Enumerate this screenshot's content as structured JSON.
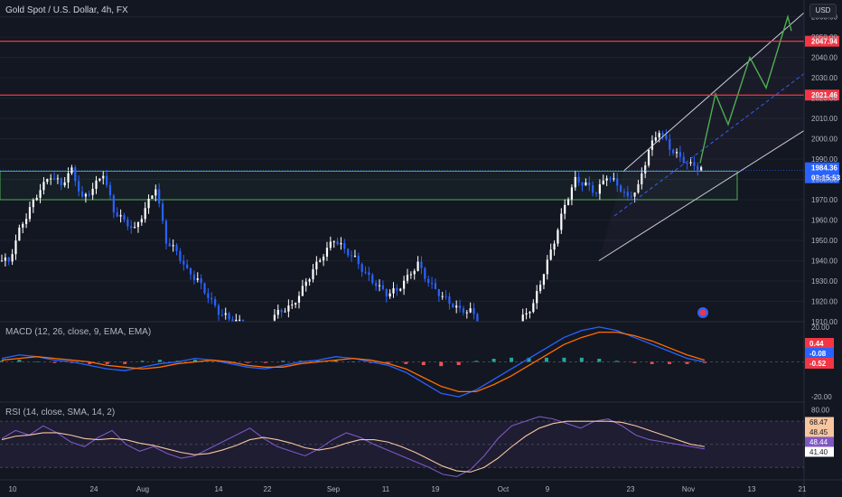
{
  "chart_title": "Gold Spot / U.S. Dollar, 4h, FX",
  "currency_button": "USD",
  "macd_label": "MACD (12, 26, close, 9, EMA, EMA)",
  "rsi_label": "RSI (14, close, SMA, 14, 2)",
  "colors": {
    "background": "#131722",
    "candle_up": "#ffffff",
    "candle_down": "#2962ff",
    "resistance_line": "#f23645",
    "zone_border": "#4caf50",
    "channel": "#d1d4dc",
    "projection": "#4caf50",
    "macd_line": "#2962ff",
    "signal_line": "#ff6d00",
    "rsi_line": "#7e57c2",
    "rsi_ma": "#f7c59f"
  },
  "chart_data": {
    "type": "candlestick",
    "price_axis": {
      "ticks": [
        "2060.00",
        "2050.00",
        "2040.00",
        "2030.00",
        "2020.00",
        "2010.00",
        "2000.00",
        "1990.00",
        "1980.00",
        "1970.00",
        "1960.00",
        "1950.00",
        "1940.00",
        "1930.00",
        "1920.00",
        "1910.00"
      ],
      "range": [
        1910,
        2062
      ]
    },
    "time_axis": [
      "10",
      "24",
      "Aug",
      "14",
      "22",
      "Sep",
      "11",
      "19",
      "Oct",
      "9",
      "23",
      "Nov",
      "13",
      "21"
    ],
    "price_labels": [
      {
        "text": "2047.94",
        "role": "resistance",
        "value": 2047.94
      },
      {
        "text": "2021.46",
        "role": "resistance",
        "value": 2021.46
      },
      {
        "text": "1984.36",
        "role": "last",
        "value": 1984.36
      },
      {
        "text": "03:15:53",
        "role": "countdown"
      }
    ],
    "zone": {
      "from": 1970,
      "to": 1984
    },
    "price_series": [
      1940,
      1955,
      1965,
      1975,
      1982,
      1978,
      1985,
      1970,
      1975,
      1983,
      1965,
      1960,
      1955,
      1965,
      1976,
      1950,
      1945,
      1935,
      1930,
      1922,
      1915,
      1912,
      1910,
      1908,
      1907,
      1912,
      1916,
      1918,
      1926,
      1935,
      1943,
      1951,
      1946,
      1941,
      1933,
      1928,
      1924,
      1926,
      1932,
      1938,
      1929,
      1924,
      1920,
      1916,
      1915,
      1909,
      1905,
      1903,
      1906,
      1912,
      1918,
      1934,
      1950,
      1968,
      1980,
      1977,
      1973,
      1982,
      1978,
      1971,
      1976,
      1994,
      2004,
      1996,
      1991,
      1987,
      1985
    ],
    "macd_axis": {
      "ticks": [
        "20.00",
        "-20.00"
      ],
      "labels": [
        "0.44",
        "-0.08",
        "-0.52"
      ],
      "range": [
        -22,
        22
      ]
    },
    "macd": [
      2,
      4,
      3,
      1,
      0,
      -2,
      -4,
      -5,
      -3,
      -1,
      0,
      2,
      1,
      -1,
      -3,
      -4,
      -2,
      0,
      1,
      3,
      2,
      0,
      -2,
      -6,
      -12,
      -18,
      -20,
      -16,
      -10,
      -4,
      2,
      8,
      14,
      18,
      20,
      18,
      14,
      10,
      6,
      2,
      0
    ],
    "macd_signal": [
      1,
      2,
      3,
      2,
      1,
      0,
      -2,
      -3,
      -4,
      -3,
      -1,
      0,
      1,
      0,
      -2,
      -3,
      -3,
      -1,
      0,
      1,
      2,
      1,
      -1,
      -4,
      -9,
      -14,
      -17,
      -17,
      -13,
      -8,
      -2,
      4,
      10,
      14,
      17,
      17,
      15,
      12,
      8,
      4,
      1
    ],
    "rsi_axis": {
      "ticks": [
        "80.00"
      ],
      "labels": [
        "68.47",
        "48.45",
        "48.44",
        "41.40"
      ],
      "range": [
        20,
        85
      ]
    },
    "rsi": [
      55,
      62,
      58,
      66,
      60,
      52,
      48,
      56,
      62,
      50,
      44,
      48,
      42,
      38,
      40,
      46,
      52,
      58,
      64,
      55,
      48,
      44,
      40,
      46,
      54,
      60,
      56,
      50,
      45,
      40,
      35,
      30,
      24,
      22,
      28,
      40,
      55,
      66,
      70,
      74,
      72,
      68,
      64,
      70,
      72,
      66,
      58,
      54,
      52,
      50,
      48,
      46
    ],
    "rsi_ma": [
      54,
      57,
      58,
      60,
      60,
      58,
      55,
      54,
      55,
      54,
      51,
      49,
      46,
      43,
      41,
      42,
      45,
      49,
      54,
      56,
      54,
      51,
      47,
      45,
      47,
      51,
      54,
      54,
      52,
      48,
      43,
      37,
      31,
      27,
      26,
      30,
      38,
      48,
      57,
      64,
      68,
      70,
      70,
      70,
      70,
      69,
      66,
      62,
      58,
      54,
      50,
      48
    ]
  }
}
